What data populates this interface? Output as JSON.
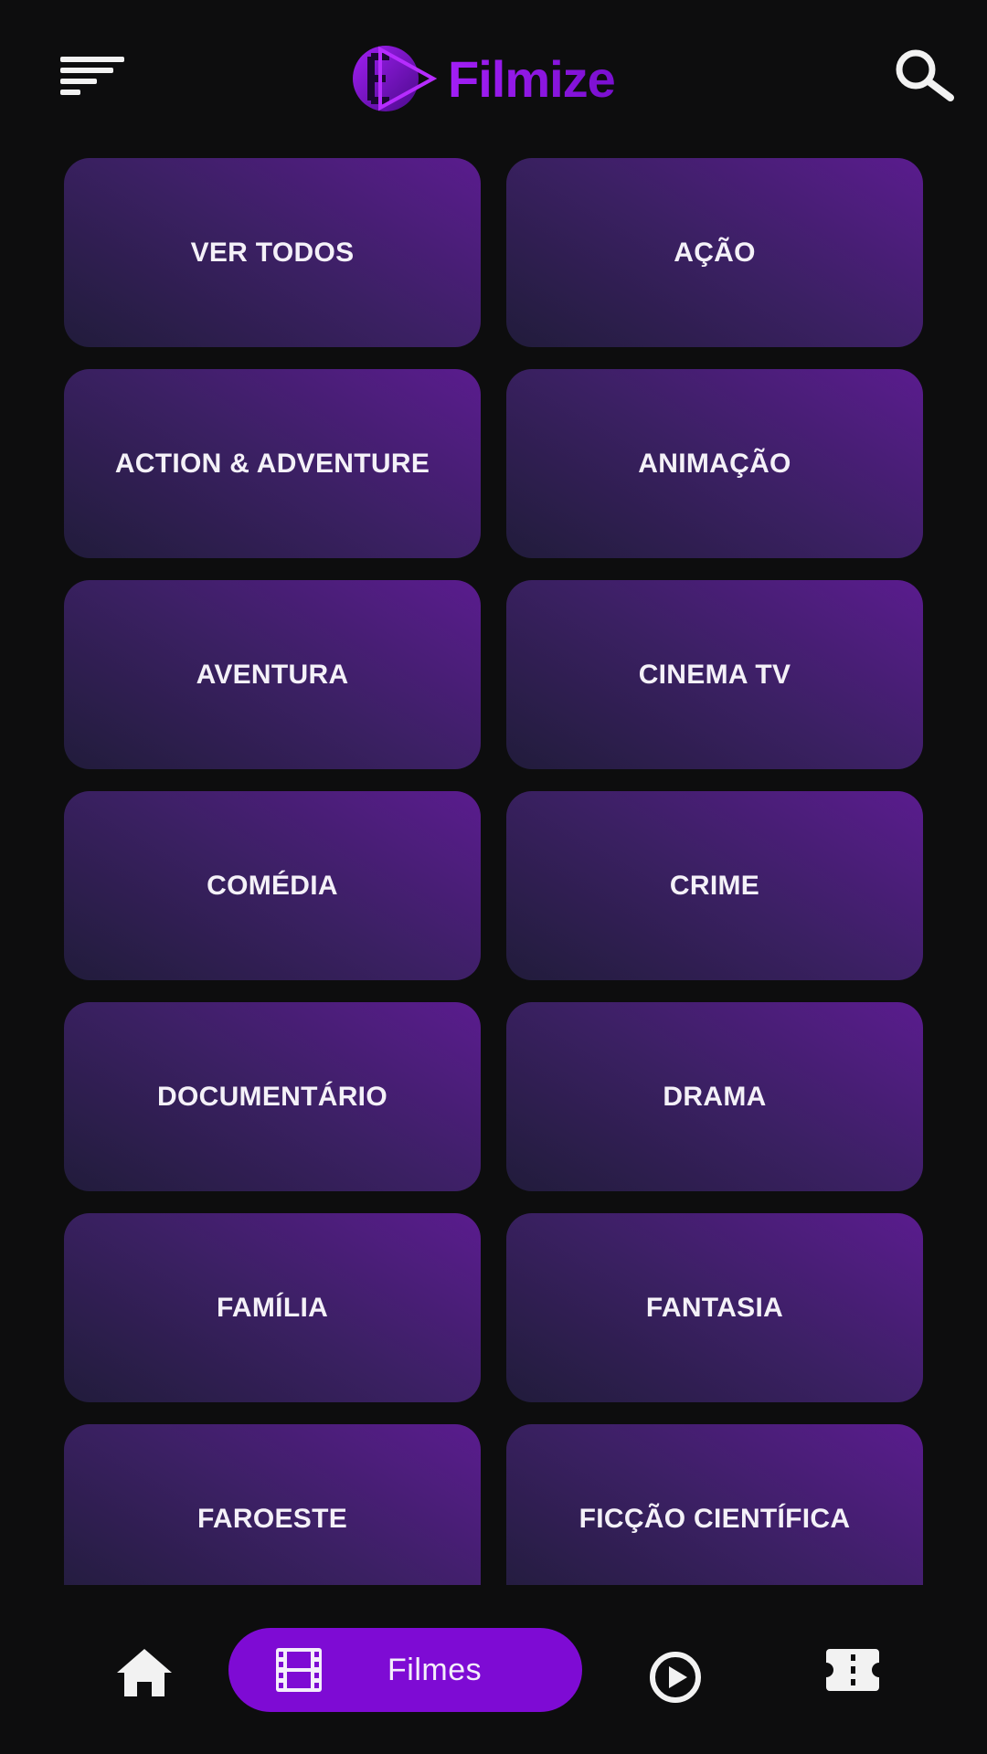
{
  "app": {
    "name": "Filmize",
    "brand_color": "#8e13e8",
    "background": "#0d0d0e"
  },
  "header": {
    "menu_icon": "hamburger-menu-icon",
    "logo_text": "Filmize",
    "search_icon": "search-icon"
  },
  "genres": [
    {
      "label": "VER TODOS"
    },
    {
      "label": "AÇÃO"
    },
    {
      "label": "ACTION & ADVENTURE"
    },
    {
      "label": "ANIMAÇÃO"
    },
    {
      "label": "AVENTURA"
    },
    {
      "label": "CINEMA TV"
    },
    {
      "label": "COMÉDIA"
    },
    {
      "label": "CRIME"
    },
    {
      "label": "DOCUMENTÁRIO"
    },
    {
      "label": "DRAMA"
    },
    {
      "label": "FAMÍLIA"
    },
    {
      "label": "FANTASIA"
    },
    {
      "label": "FAROESTE"
    },
    {
      "label": "FICÇÃO CIENTÍFICA"
    }
  ],
  "bottom_nav": {
    "items": [
      {
        "icon": "home-icon",
        "label": "",
        "active": false
      },
      {
        "icon": "film-strip-icon",
        "label": "Filmes",
        "active": true
      },
      {
        "icon": "play-circle-icon",
        "label": "",
        "active": false
      },
      {
        "icon": "ticket-icon",
        "label": "",
        "active": false
      }
    ],
    "active_color": "#7e0bd4"
  }
}
